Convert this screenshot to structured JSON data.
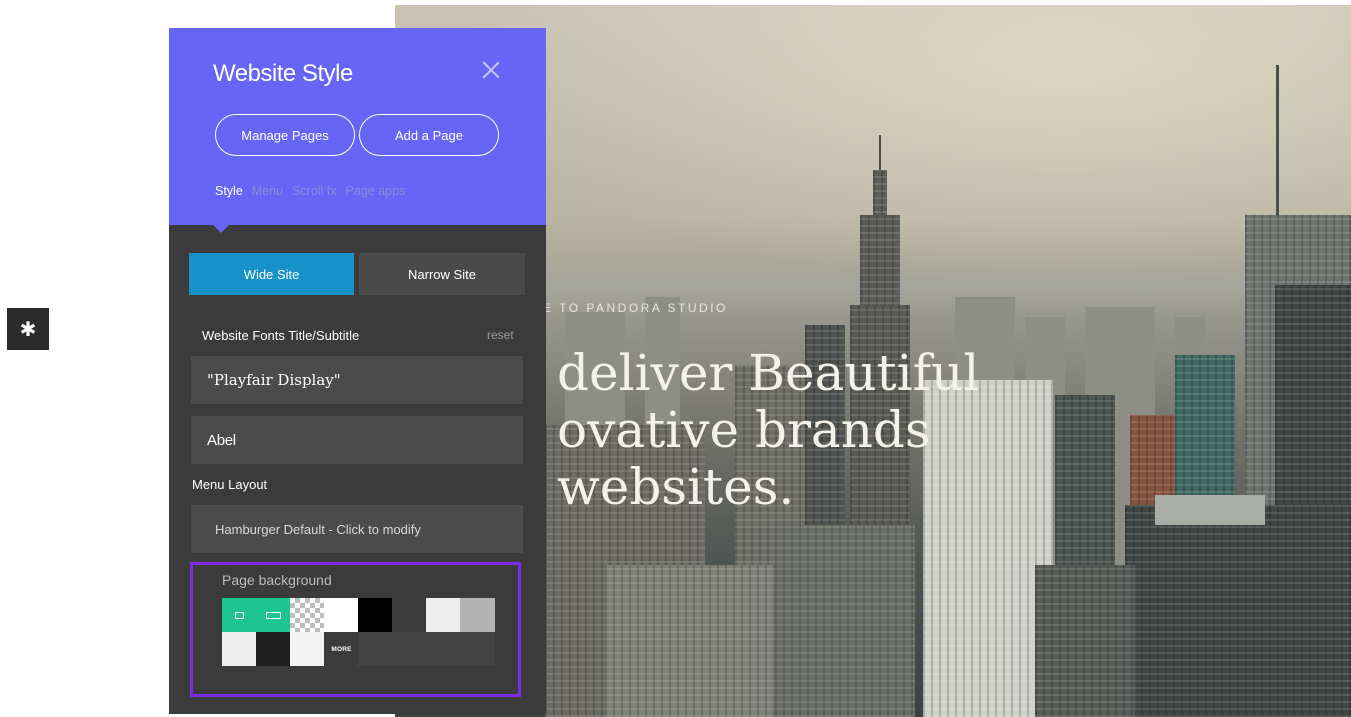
{
  "hero": {
    "subtitle": "E TO PANDORA STUDIO",
    "headline_lines": [
      "deliver Beautiful",
      "ovative brands",
      "websites."
    ]
  },
  "gear": {
    "icon": "gear-icon"
  },
  "panel": {
    "title": "Website Style",
    "close_icon": "close-icon",
    "buttons": {
      "manage_pages": "Manage Pages",
      "add_page": "Add a Page"
    },
    "tabs": [
      {
        "label": "Style",
        "active": true
      },
      {
        "label": "Menu",
        "active": false
      },
      {
        "label": "Scroll fx",
        "active": false
      },
      {
        "label": "Page apps",
        "active": false
      }
    ],
    "site_width": {
      "wide": "Wide Site",
      "narrow": "Narrow Site",
      "selected": "Wide Site"
    },
    "fonts": {
      "label": "Website Fonts Title/Subtitle",
      "reset": "reset",
      "title_font": "\"Playfair Display\"",
      "subtitle_font": "Abel"
    },
    "menu_layout": {
      "label": "Menu Layout",
      "value": "Hamburger Default - Click to modify"
    },
    "page_background": {
      "label": "Page background",
      "more_label": "MORE",
      "swatches_row1": [
        "#1fc591",
        "#1fc591",
        "checker",
        "#ffffff",
        "#000000",
        "#3b3b3b",
        "#eeeeee",
        "#b3b3b3"
      ],
      "swatches_row2": [
        "#eeeeee",
        "#1f1f1f",
        "#f2f2f2",
        "more",
        "#444444"
      ]
    },
    "colors": {
      "header": "#6566f5",
      "body": "#3b3b3b",
      "accent": "#1792c9",
      "highlight": "#7d2be8"
    }
  }
}
